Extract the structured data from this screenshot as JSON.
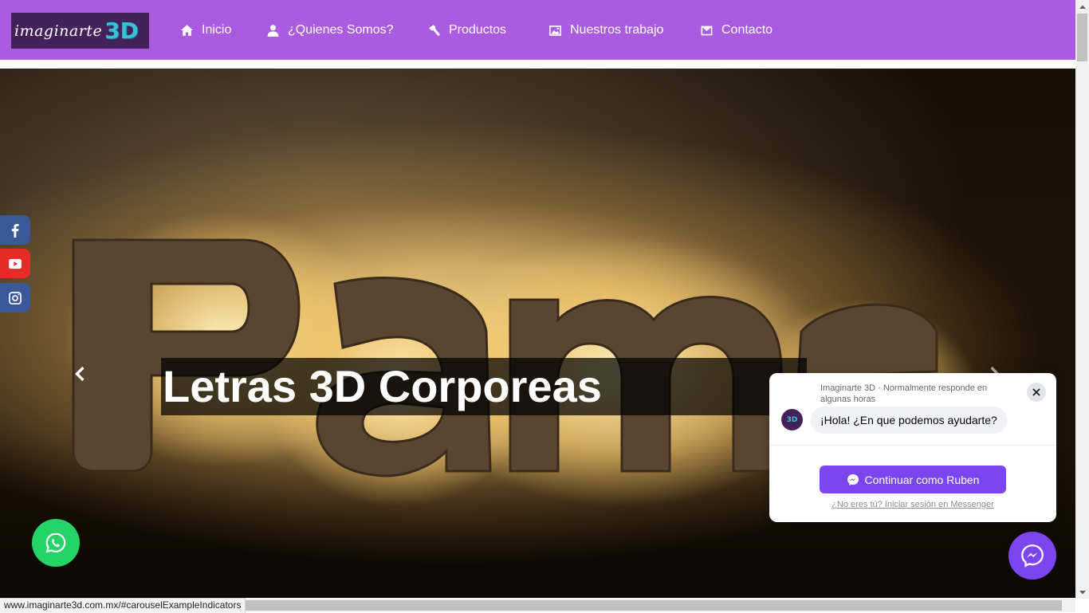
{
  "site": {
    "logo_word": "imaginarte",
    "logo_3d": "3D",
    "brand_color": "#ab5be0"
  },
  "nav": {
    "items": [
      {
        "label": "Inicio",
        "icon": "home-icon"
      },
      {
        "label": "¿Quienes Somos?",
        "icon": "user-icon"
      },
      {
        "label": "Productos",
        "icon": "hammer-icon"
      },
      {
        "label": "Nuestros trabajo",
        "icon": "picture-icon"
      },
      {
        "label": "Contacto",
        "icon": "envelope-icon"
      }
    ]
  },
  "carousel": {
    "caption": "Letras 3D Corporeas",
    "prev_icon": "chevron-left-icon",
    "next_icon": "chevron-right-icon"
  },
  "social": {
    "items": [
      {
        "name": "facebook",
        "icon": "facebook-icon",
        "color": "#3b5998"
      },
      {
        "name": "youtube",
        "icon": "youtube-icon",
        "color": "#e52d27"
      },
      {
        "name": "instagram",
        "icon": "instagram-icon",
        "color": "#3b5998"
      }
    ]
  },
  "whatsapp": {
    "icon": "whatsapp-icon",
    "color": "#25d366"
  },
  "messenger_chat": {
    "page_name": "Imaginarte 3D",
    "response_info": "Imaginarte 3D · Normalmente responde en algunas horas",
    "avatar_text": "3D",
    "greeting": "¡Hola! ¿En que podemos ayudarte?",
    "continue_label": "Continuar como Ruben",
    "alt_link": "¿No eres tú? Iniciar sesión en Messenger",
    "accent": "#7b45f0"
  },
  "browser": {
    "status_url": "www.imaginarte3d.com.mx/#carouselExampleIndicators"
  }
}
